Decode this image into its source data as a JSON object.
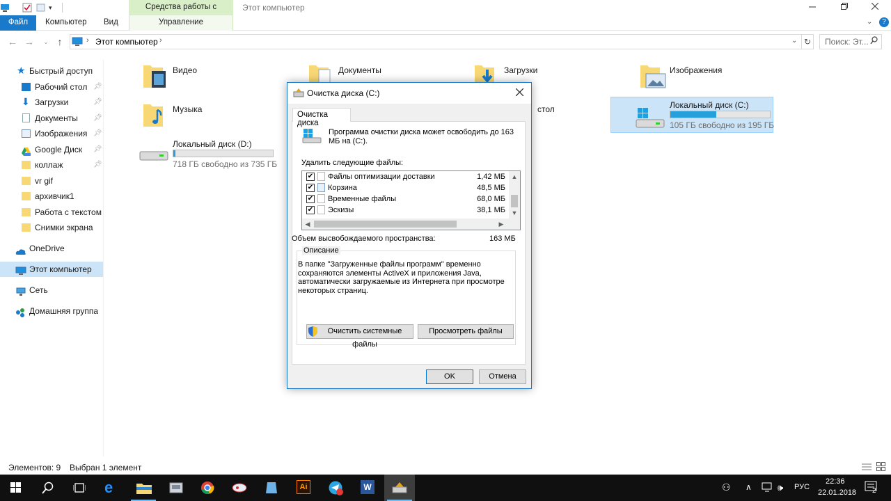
{
  "colors": {
    "accent": "#1979ca",
    "disk_tools_tab": "#d8efc8",
    "selection": "#cce4f7",
    "drive_fill": "#26a0da",
    "taskbar": "#101010"
  },
  "titlebar": {
    "context_tab": "Средства работы с дисками",
    "window_title": "Этот компьютер",
    "minimize_icon": "minimize-icon",
    "maximize_icon": "restore-icon",
    "close_icon": "close-icon"
  },
  "ribbon": {
    "tabs": [
      "Файл",
      "Компьютер",
      "Вид",
      "Управление"
    ]
  },
  "address_bar": {
    "path": "Этот компьютер",
    "search_placeholder": "Поиск: Эт..."
  },
  "sidebar": {
    "items": [
      {
        "label": "Быстрый доступ",
        "icon": "star-icon",
        "pinned": false
      },
      {
        "label": "Рабочий стол",
        "icon": "desktop-icon",
        "pinned": true
      },
      {
        "label": "Загрузки",
        "icon": "download-icon",
        "pinned": true
      },
      {
        "label": "Документы",
        "icon": "document-icon",
        "pinned": true
      },
      {
        "label": "Изображения",
        "icon": "pictures-icon",
        "pinned": true
      },
      {
        "label": "Google Диск",
        "icon": "google-drive-icon",
        "pinned": true
      },
      {
        "label": "коллаж",
        "icon": "folder-icon",
        "pinned": true
      },
      {
        "label": "vr gif",
        "icon": "folder-icon",
        "pinned": false
      },
      {
        "label": "архивчик1",
        "icon": "folder-icon",
        "pinned": false
      },
      {
        "label": "Работа с текстом",
        "icon": "folder-icon",
        "pinned": false
      },
      {
        "label": "Снимки экрана",
        "icon": "folder-icon",
        "pinned": false
      },
      {
        "label": "OneDrive",
        "icon": "onedrive-icon",
        "pinned": false
      },
      {
        "label": "Этот компьютер",
        "icon": "computer-icon",
        "pinned": false,
        "selected": true
      },
      {
        "label": "Сеть",
        "icon": "network-icon",
        "pinned": false
      },
      {
        "label": "Домашняя группа",
        "icon": "homegroup-icon",
        "pinned": false
      }
    ]
  },
  "content": {
    "folders": [
      {
        "label": "Видео",
        "icon": "video-folder-icon"
      },
      {
        "label": "Документы",
        "icon": "documents-folder-icon"
      },
      {
        "label": "Загрузки",
        "icon": "downloads-folder-icon"
      },
      {
        "label": "Изображения",
        "icon": "pictures-folder-icon"
      },
      {
        "label": "Музыка",
        "icon": "music-folder-icon"
      },
      {
        "label": "стол",
        "icon": "desktop-folder-icon"
      }
    ],
    "drives": [
      {
        "label": "Локальный диск (C:)",
        "free": "105 ГБ свободно из 195 ГБ",
        "used_fraction": 0.46,
        "selected": true
      },
      {
        "label": "Локальный диск (D:)",
        "free": "718 ГБ свободно из 735 ГБ",
        "used_fraction": 0.02,
        "selected": false
      }
    ]
  },
  "statusbar": {
    "items_count": "Элементов: 9",
    "selected_count": "Выбран 1 элемент"
  },
  "dialog": {
    "title": "Очистка диска  (C:)",
    "tab": "Очистка диска",
    "intro": "Программа очистки диска может освободить до 163 МБ на  (C:).",
    "files_label": "Удалить следующие файлы:",
    "files": [
      {
        "name": "Файлы оптимизации доставки",
        "size": "1,42 МБ",
        "checked": true
      },
      {
        "name": "Корзина",
        "size": "48,5 МБ",
        "checked": true
      },
      {
        "name": "Временные файлы",
        "size": "68,0 МБ",
        "checked": true
      },
      {
        "name": "Эскизы",
        "size": "38,1 МБ",
        "checked": true
      }
    ],
    "space_label": "Объем высвобождаемого пространства:",
    "space_value": "163 МБ",
    "description_legend": "Описание",
    "description": "В папке \"Загруженные файлы программ\" временно сохраняются элементы ActiveX и приложения Java, автоматически загружаемые из Интернета при просмотре некоторых страниц.",
    "clean_system_button": "Очистить системные файлы",
    "view_files_button": "Просмотреть файлы",
    "ok_button": "OK",
    "cancel_button": "Отмена"
  },
  "taskbar": {
    "apps": [
      "start-icon",
      "search-icon",
      "task-view-icon",
      "edge-icon",
      "file-explorer-icon",
      "app-icon",
      "chrome-icon",
      "app-icon",
      "app-icon",
      "illustrator-icon",
      "telegram-icon",
      "word-icon",
      "disk-cleanup-icon"
    ],
    "language": "РУС",
    "time": "22:36",
    "date": "22.01.2018",
    "notifications": "2"
  }
}
